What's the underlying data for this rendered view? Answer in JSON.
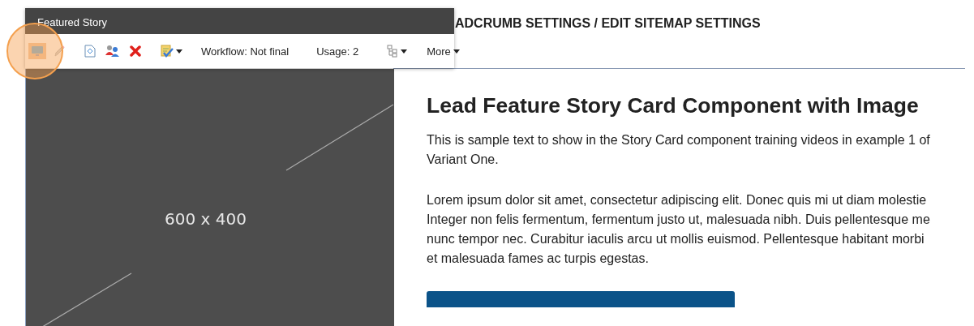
{
  "breadcrumb": "ADCRUMB SETTINGS / EDIT SITEMAP SETTINGS",
  "editor_overlay": {
    "title": "Featured Story",
    "toolbar": [
      {
        "kind": "button",
        "selected": true,
        "disabled": false
      },
      {
        "kind": "button",
        "selected": false,
        "disabled": true
      },
      {
        "kind": "separator"
      },
      {
        "kind": "button",
        "selected": false,
        "disabled": false
      },
      {
        "kind": "button",
        "selected": false,
        "disabled": false
      },
      {
        "kind": "button",
        "selected": false,
        "disabled": false
      },
      {
        "kind": "separator"
      },
      {
        "kind": "dropdown"
      },
      {
        "kind": "separator"
      },
      {
        "kind": "text",
        "label": "Workflow: Not final"
      },
      {
        "kind": "separator"
      },
      {
        "kind": "text",
        "label": "Usage: 2"
      },
      {
        "kind": "separator"
      },
      {
        "kind": "dropdown"
      },
      {
        "kind": "separator"
      },
      {
        "kind": "menu",
        "label": "More"
      }
    ]
  },
  "image_placeholder": {
    "label": "600 x 400"
  },
  "story": {
    "title": "Lead Feature Story Card Component with Image",
    "paragraphs": [
      [
        "This is sample text to show in the Story Card component training videos in example 1 of",
        "Variant One."
      ],
      [
        "Lorem ipsum dolor sit amet, consectetur adipiscing elit. Donec quis mi ut diam molestie",
        "Integer non felis fermentum, fermentum justo ut, malesuada nibh. Duis pellentesque me",
        "nunc tempor nec. Curabitur iaculis arcu ut mollis euismod. Pellentesque habitant morbi",
        "et malesuada fames ac turpis egestas."
      ]
    ]
  }
}
